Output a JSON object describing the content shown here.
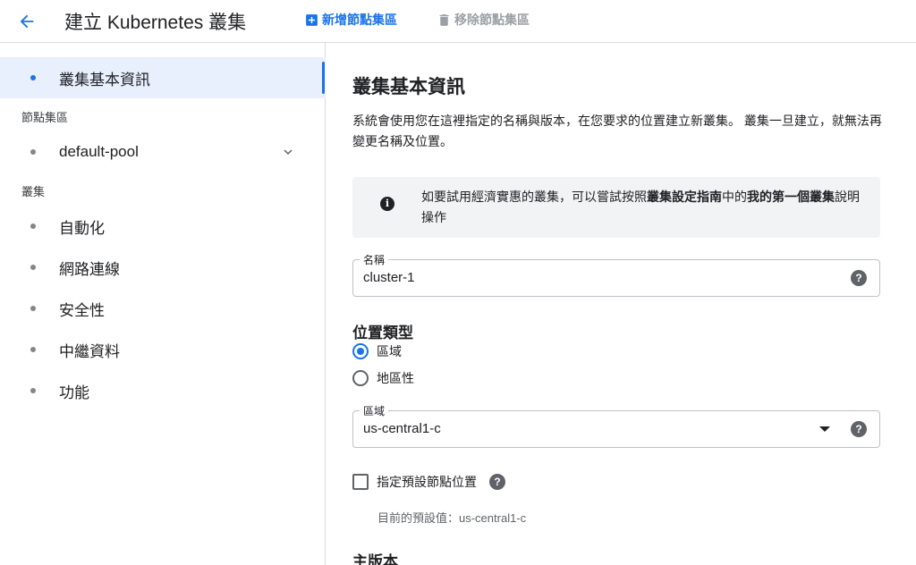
{
  "header": {
    "title": "建立 Kubernetes 叢集",
    "add_node_pool_label": "新增節點集區",
    "remove_node_pool_label": "移除節點集區"
  },
  "sidebar": {
    "active_item": "叢集基本資訊",
    "node_pool_section": "節點集區",
    "node_pool_item": "default-pool",
    "cluster_section": "叢集",
    "cluster_items": [
      "自動化",
      "網路連線",
      "安全性",
      "中繼資料",
      "功能"
    ]
  },
  "main": {
    "title": "叢集基本資訊",
    "description": "系統會使用您在這裡指定的名稱與版本，在您要求的位置建立新叢集。 叢集一旦建立，就無法再變更名稱及位置。",
    "info": {
      "part1": "如要試用經濟實惠的叢集，可以嘗試按照",
      "bold1": "叢集設定指南",
      "part2": "中的",
      "bold2": "我的第一個叢集",
      "part3": "說明操作"
    },
    "name_field": {
      "label": "名稱",
      "value": "cluster-1"
    },
    "location_type": {
      "title": "位置類型",
      "options": [
        "區域",
        "地區性"
      ],
      "selected": "區域"
    },
    "zone_field": {
      "label": "區域",
      "value": "us-central1-c"
    },
    "specify_node_locations": {
      "label": "指定預設節點位置",
      "checked": false
    },
    "default_value_note": "目前的預設值：us-central1-c",
    "version_title": "主版本"
  },
  "colors": {
    "accent": "#1a73e8",
    "active_bg": "#e8f0fe",
    "info_bg": "#f1f3f4"
  }
}
